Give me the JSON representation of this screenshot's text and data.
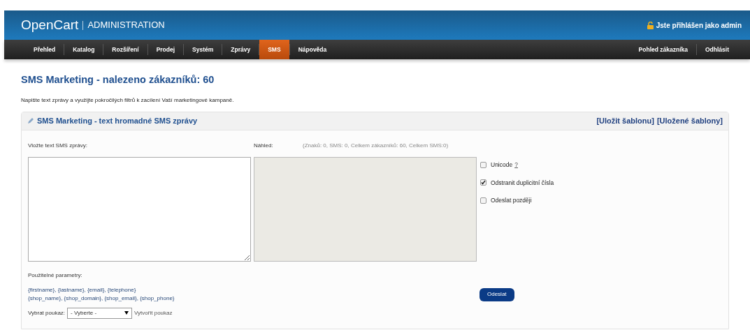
{
  "header": {
    "logo": "OpenCart",
    "subtitle": "ADMINISTRATION",
    "user_info": "Jste přihlášen jako admin"
  },
  "nav": {
    "items": [
      {
        "label": "Přehled",
        "selected": false
      },
      {
        "label": "Katalog",
        "selected": false
      },
      {
        "label": "Rozšíření",
        "selected": false
      },
      {
        "label": "Prodej",
        "selected": false
      },
      {
        "label": "Systém",
        "selected": false
      },
      {
        "label": "Zprávy",
        "selected": false
      },
      {
        "label": "SMS",
        "selected": true
      },
      {
        "label": "Nápověda",
        "selected": false
      }
    ],
    "right_items": [
      "Pohled zákazníka",
      "Odhlásit"
    ]
  },
  "page": {
    "title": "SMS Marketing - nalezeno zákazníků: 60",
    "description": "Napište text zprávy a využijte pokročilých filtrů k zacílení Vaší marketingové kampaně."
  },
  "panel": {
    "title": "SMS Marketing - text hromadné SMS zprávy",
    "links": [
      "[Uložit šablonu]",
      "[Uložené šablony]"
    ],
    "message_label": "Vložte text SMS zprávy:",
    "preview_label": "Náhled:",
    "counter": "(Znaků: 0, SMS: 0, Celkem zákazníků: 60, Celkem SMS:0)",
    "options": [
      {
        "label": "Unicode",
        "help": "?",
        "checked": false
      },
      {
        "label": "Odstranit duplicitní čísla",
        "checked": true
      },
      {
        "label": "Odeslat později",
        "checked": false
      }
    ],
    "params_label": "Použitelné parametry:",
    "params": [
      "{firstname}, {lastname}, {email}, {telephone}",
      "{shop_name}, {shop_domain}, {shop_email}, {shop_phone}"
    ],
    "voucher_label": "Vybrat poukaz:",
    "voucher_select": "- Vyberte -",
    "voucher_link": "Vytvořit poukaz",
    "send_button": "Odeslat"
  }
}
